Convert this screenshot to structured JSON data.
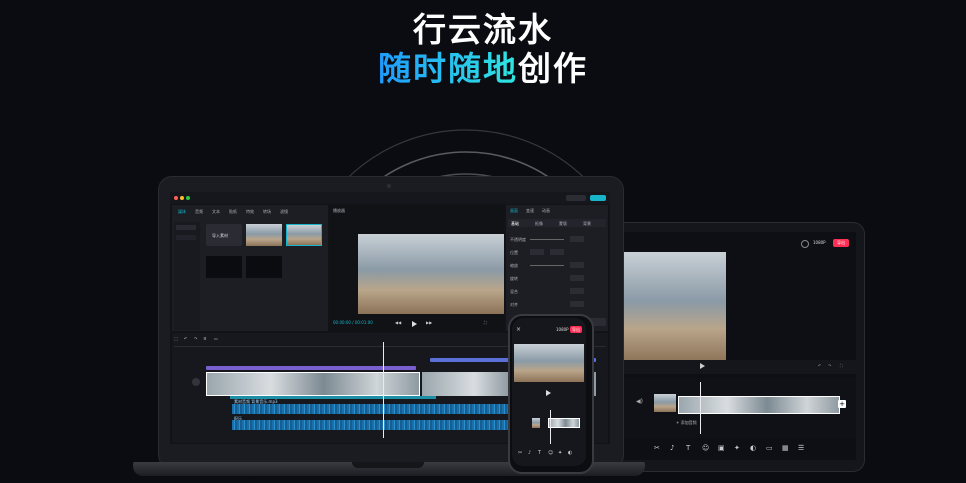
{
  "headline": {
    "line1": "行云流水",
    "line2_highlight": "随时随地",
    "line2_rest": "创作"
  },
  "colors": {
    "background": "#0b0c12",
    "gradient_start": "#1e9bff",
    "gradient_end": "#2fe6e0",
    "accent_teal": "#17b5c9",
    "export_red": "#ff2e54",
    "audio_blue": "#2a8fd0"
  },
  "laptop_editor": {
    "player_title": "播放器",
    "timecode": "00:00:00 / 00:01:00",
    "panel_tabs": [
      "画面",
      "变速",
      "动画"
    ],
    "panel_subtabs": [
      "基础",
      "抠像",
      "蒙版",
      "背景"
    ],
    "panel_rows": [
      "不透明度",
      "位置",
      "缩放",
      "旋转",
      "混合",
      "对齐"
    ],
    "import_label": "导入素材",
    "media_tabs": [
      "媒体",
      "音频",
      "文本",
      "贴纸",
      "特效",
      "转场",
      "滤镜"
    ],
    "audio_track_label": "素材音频 背景音乐.mp3",
    "audio_track_label_2": "配乐"
  },
  "tablet_editor": {
    "export_label": "导出",
    "resolution_label": "1080P",
    "add_label": "+ 添加音频"
  },
  "phone_editor": {
    "export_label": "导出",
    "resolution_label": "1080P"
  }
}
